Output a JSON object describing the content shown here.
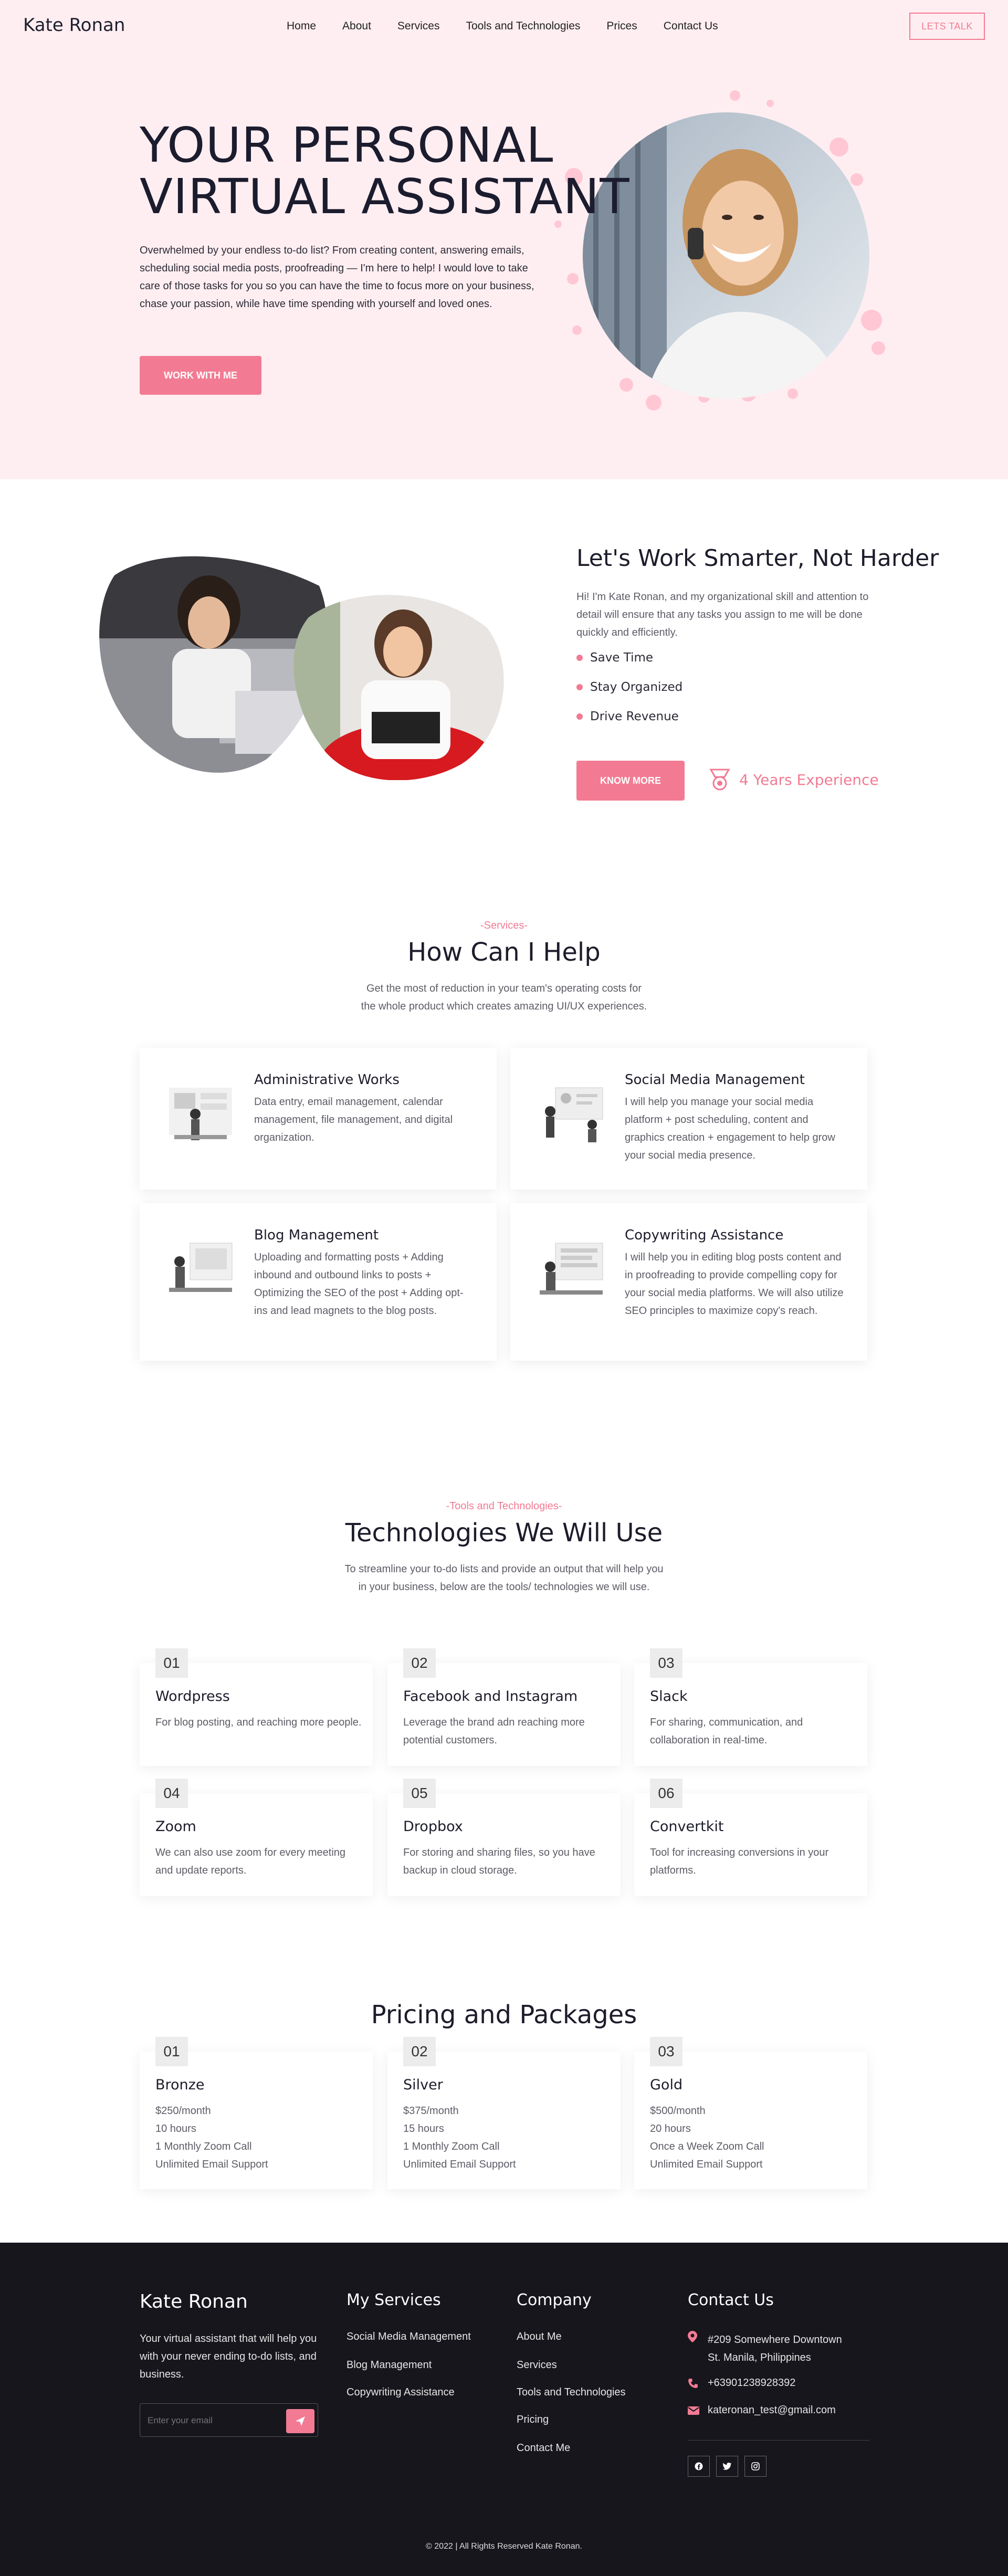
{
  "brand": "Kate Ronan",
  "nav": {
    "items": [
      "Home",
      "About",
      "Services",
      "Tools and Technologies",
      "Prices",
      "Contact Us"
    ],
    "cta": "LETS TALK"
  },
  "hero": {
    "title_line1": "YOUR PERSONAL",
    "title_line2": "VIRTUAL ASSISTANT",
    "text": "Overwhelmed by your endless to-do list? From creating content, answering emails, scheduling social media posts, proofreading — I'm here to help! I would love to take care of those tasks for you so you can have the time to focus more on your business, chase your passion, while have time spending with yourself and loved ones.",
    "button": "WORK WITH ME"
  },
  "about": {
    "title": "Let's Work Smarter, Not Harder",
    "text": "Hi! I'm Kate Ronan, and my organizational skill and attention to detail will ensure that any tasks you assign to me will be done quickly and efficiently.",
    "bullets": [
      "Save Time",
      "Stay Organized",
      "Drive Revenue"
    ],
    "button": "KNOW MORE",
    "experience": "4 Years Experience"
  },
  "services": {
    "tag": "-Services-",
    "title": "How Can I Help",
    "subtitle_line1": "Get the most of reduction in your team's operating costs for",
    "subtitle_line2": "the whole product which creates amazing UI/UX experiences.",
    "cards": [
      {
        "title": "Administrative Works",
        "text": "Data entry, email management, calendar management, file management, and digital organization."
      },
      {
        "title": "Social Media Management",
        "text": "I will help you manage your social media platform + post scheduling, content and graphics creation + engagement to help grow your social media presence."
      },
      {
        "title": "Blog Management",
        "text": "Uploading and formatting posts + Adding inbound and outbound links to posts + Optimizing the SEO of the post + Adding opt-ins and lead magnets to the blog posts."
      },
      {
        "title": "Copywriting Assistance",
        "text": "I will help you in editing blog posts content and in proofreading to provide compelling copy for your social media platforms. We will also utilize SEO principles to maximize copy's reach."
      }
    ]
  },
  "tools": {
    "tag": "-Tools and Technologies-",
    "title": "Technologies We Will Use",
    "subtitle": "To streamline your to-do lists and provide an output that will help you in your business, below are the tools/ technologies we will use.",
    "items": [
      {
        "num": "01",
        "title": "Wordpress",
        "text": "For blog posting, and reaching more people."
      },
      {
        "num": "02",
        "title": "Facebook and Instagram",
        "text": "Leverage the brand adn reaching more potential customers."
      },
      {
        "num": "03",
        "title": "Slack",
        "text": "For sharing, communication, and collaboration in real-time."
      },
      {
        "num": "04",
        "title": "Zoom",
        "text": "We can also use zoom for every meeting and update reports."
      },
      {
        "num": "05",
        "title": "Dropbox",
        "text": "For storing and sharing files, so you have backup in cloud storage."
      },
      {
        "num": "06",
        "title": "Convertkit",
        "text": "Tool for increasing conversions in your platforms."
      }
    ]
  },
  "pricing": {
    "title": "Pricing and Packages",
    "plans": [
      {
        "num": "01",
        "title": "Bronze",
        "lines": [
          "$250/month",
          "10 hours",
          "1 Monthly Zoom Call",
          "Unlimited Email Support"
        ]
      },
      {
        "num": "02",
        "title": "Silver",
        "lines": [
          "$375/month",
          "15 hours",
          "1 Monthly Zoom Call",
          "Unlimited Email Support"
        ]
      },
      {
        "num": "03",
        "title": "Gold",
        "lines": [
          "$500/month",
          "20 hours",
          "Once a Week Zoom Call",
          "Unlimited Email Support"
        ]
      }
    ]
  },
  "footer": {
    "brand": "Kate Ronan",
    "tagline": "Your virtual assistant that will help you with your never ending to-do lists, and business.",
    "email_placeholder": "Enter your email",
    "services_title": "My Services",
    "services": [
      "Social Media Management",
      "Blog Management",
      "Copywriting Assistance"
    ],
    "company_title": "Company",
    "company": [
      "About Me",
      "Services",
      "Tools and Technologies",
      "Pricing",
      "Contact Me"
    ],
    "contact_title": "Contact Us",
    "address_line1": "#209 Somewhere Downtown",
    "address_line2": "St. Manila, Philippines",
    "phone": "+63901238928392",
    "email": "kateronan_test@gmail.com",
    "copyright": "© 2022 | All Rights Reserved Kate Ronan.",
    "colors": {
      "bg": "#17161d",
      "accent": "#f27b93"
    }
  },
  "colors": {
    "accent": "#f27b93",
    "hero_bg": "#ffeef1",
    "heading": "#1c1c2b"
  }
}
